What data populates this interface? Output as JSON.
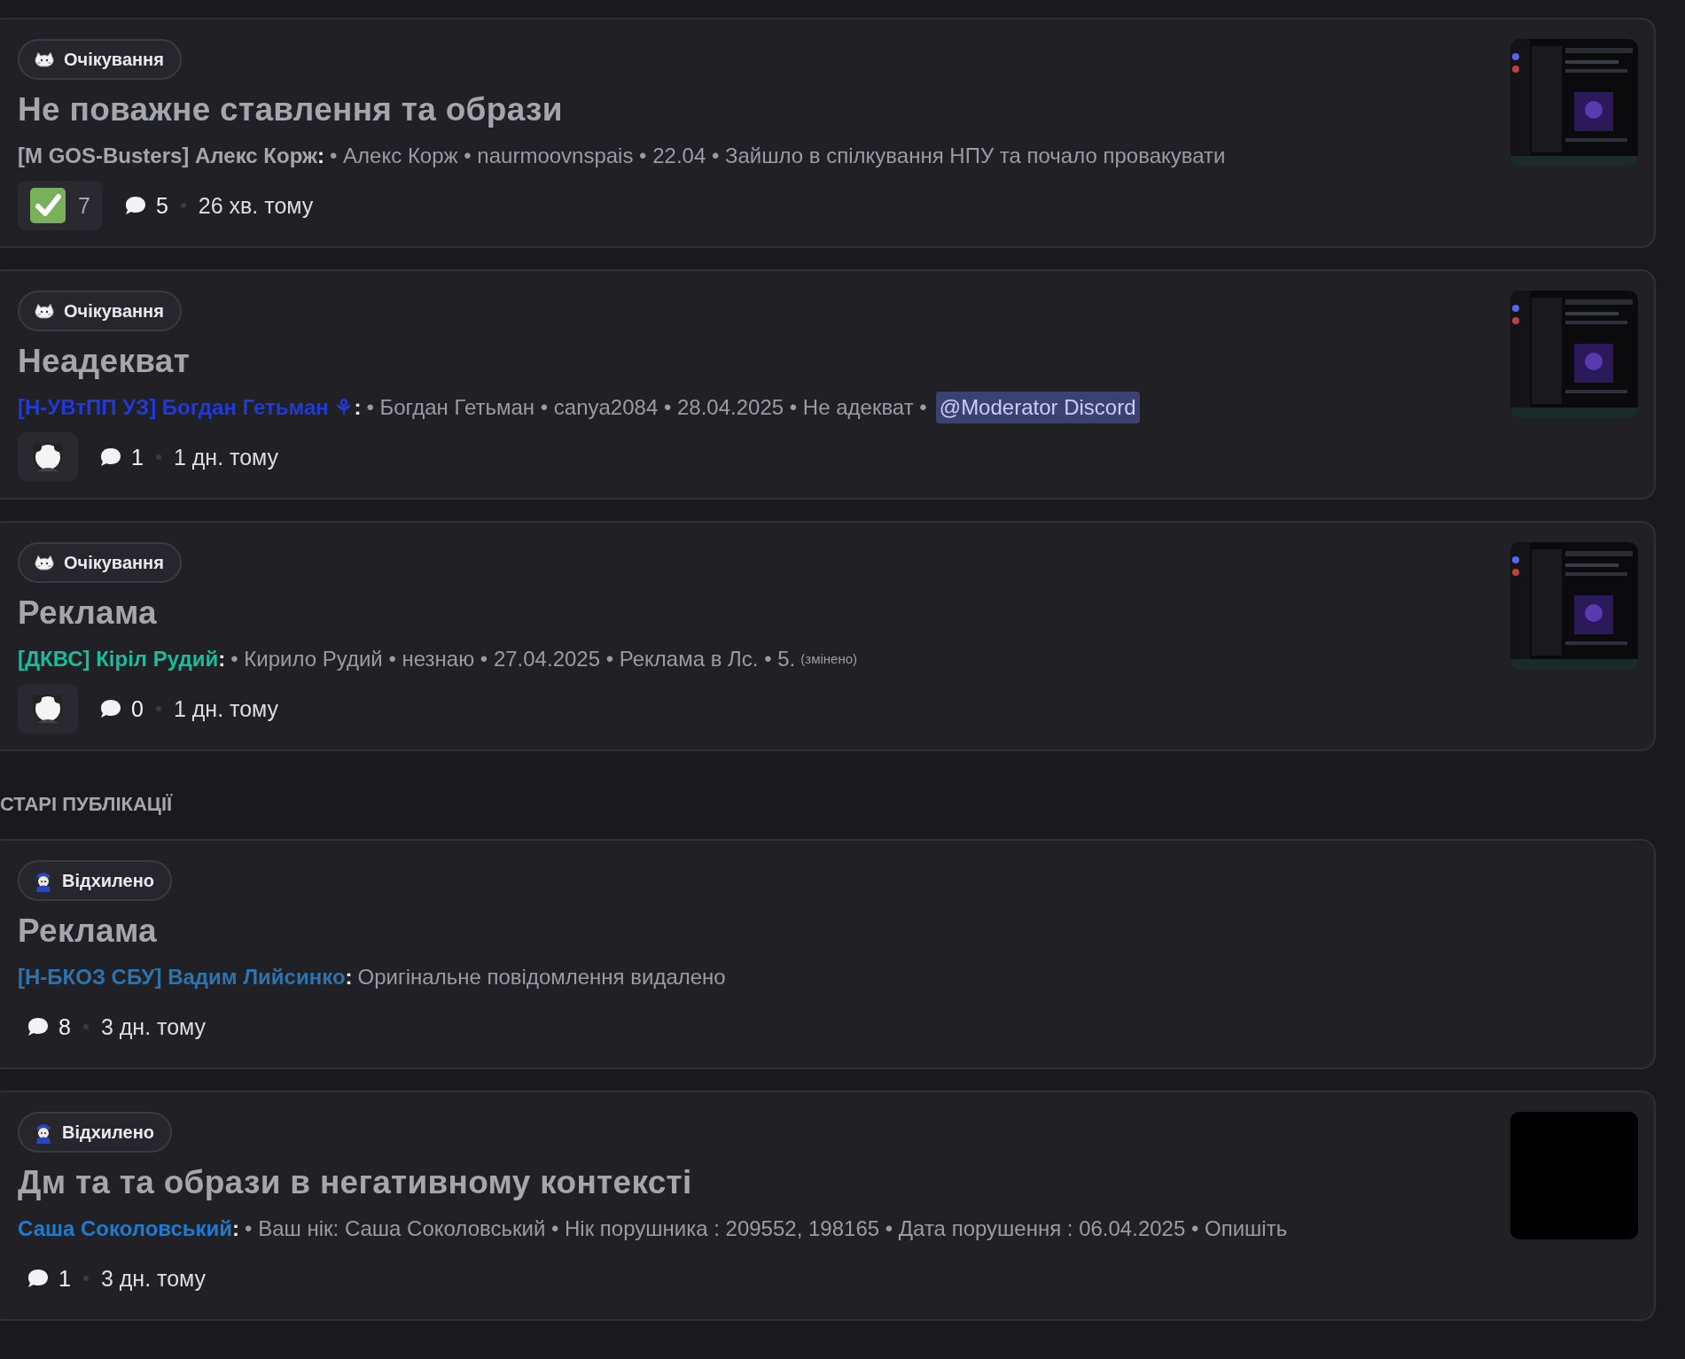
{
  "posts": [
    {
      "tag": {
        "label": "Очікування",
        "kind": "pending"
      },
      "title": "Не поважне ставлення та образи",
      "author": {
        "name": "[M GOS-Busters] Алекс Корж",
        "color": "#a5a6ab"
      },
      "separator": ":",
      "message": "• Алекс Корж  • naurmoovnspais  • 22.04  • Зайшло в спілкування НПУ та почало провакувати",
      "footer_badge": {
        "kind": "reaction",
        "count": "7"
      },
      "comments": "5",
      "time": "26 хв. тому"
    },
    {
      "tag": {
        "label": "Очікування",
        "kind": "pending"
      },
      "title": "Неадекват",
      "author": {
        "name": "[Н-УВтПП УЗ] Богдан Гетьман ⚘",
        "color": "#1f3ad8"
      },
      "separator": ":",
      "message": "• Богдан Гетьман  • canya2084  • 28.04.2025  • Не адекват  •",
      "mention": "@Moderator Discord",
      "footer_badge": {
        "kind": "avatar"
      },
      "comments": "1",
      "time": "1 дн. тому"
    },
    {
      "tag": {
        "label": "Очікування",
        "kind": "pending"
      },
      "title": "Реклама",
      "author": {
        "name": "[ДКВС] Кіріл Рудий",
        "color": "#1abc9c"
      },
      "separator": ":",
      "message": "• Кирило Рудий  • незнаю  • 27.04.2025  • Реклама в Лс.  • 5.",
      "edited": "(змінено)",
      "footer_badge": {
        "kind": "avatar"
      },
      "comments": "0",
      "time": "1 дн. тому"
    },
    {
      "section": "СТАРІ ПУБЛІКАЦІЇ"
    },
    {
      "tag": {
        "label": "Відхилено",
        "kind": "rejected"
      },
      "title": "Реклама",
      "author": {
        "name": "[Н-БКОЗ СБУ] Вадим Лийсинко",
        "color": "#2d73ad"
      },
      "separator": ":",
      "message": "Оригінальне повідомлення видалено",
      "comments": "8",
      "time": "3 дн. тому"
    },
    {
      "tag": {
        "label": "Відхилено",
        "kind": "rejected"
      },
      "title": "Дм та та образи в негативному контексті",
      "author": {
        "name": "Саша Соколовський",
        "color": "#1e7bd0"
      },
      "separator": ":",
      "message": "• Ваш нік: Саша Соколовський  • Нік порушника : 209552, 198165  • Дата порушення : 06.04.2025  • Опишіть",
      "comments": "1",
      "time": "3 дн. тому",
      "thumbnail": {
        "kind": "blank"
      }
    }
  ]
}
